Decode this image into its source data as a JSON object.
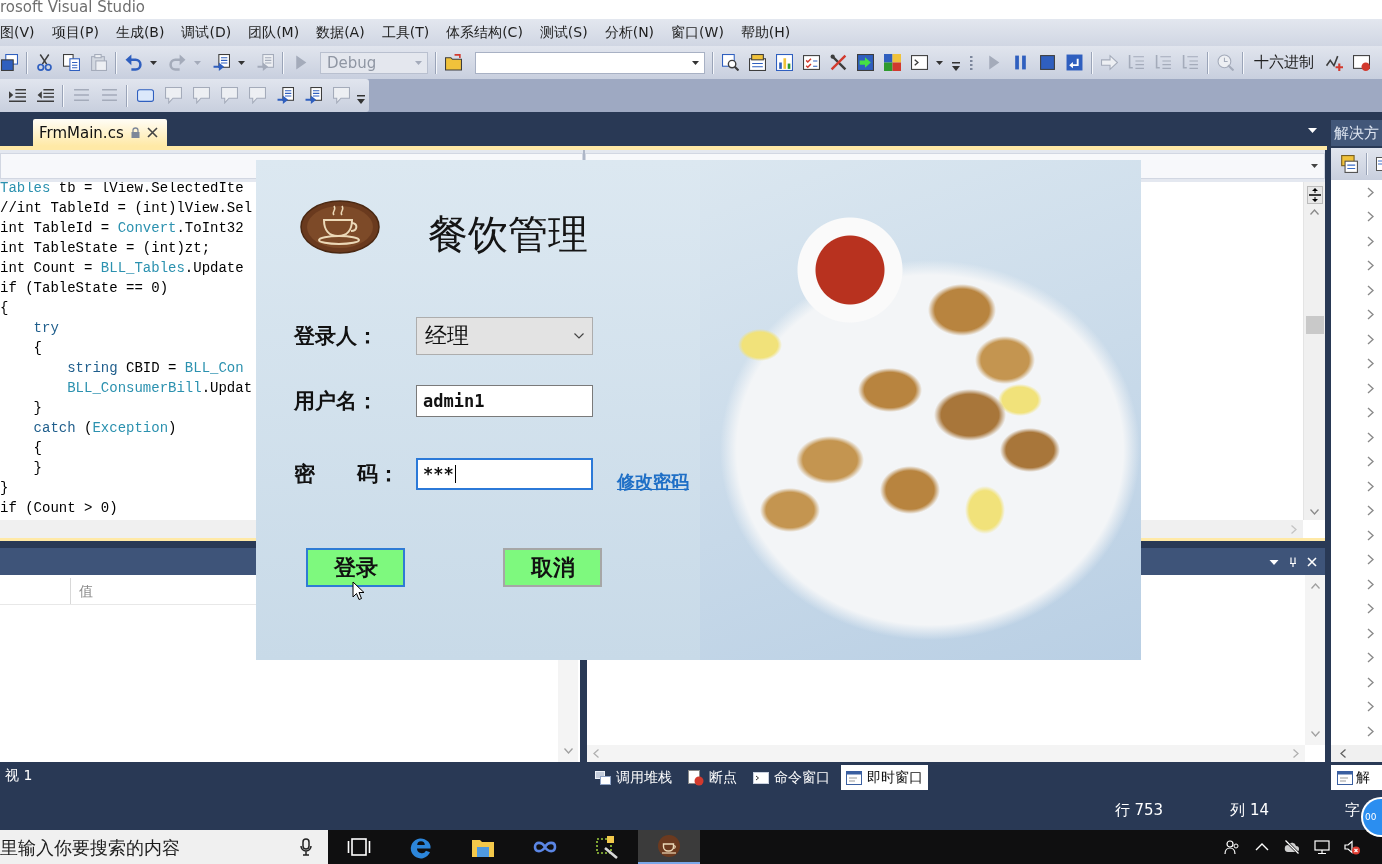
{
  "window": {
    "title": "rosoft Visual Studio"
  },
  "menu": [
    "图(V)",
    "项目(P)",
    "生成(B)",
    "调试(D)",
    "团队(M)",
    "数据(A)",
    "工具(T)",
    "体系结构(C)",
    "测试(S)",
    "分析(N)",
    "窗口(W)",
    "帮助(H)"
  ],
  "toolbar_1": [
    {
      "kind": "button",
      "disabled": false
    },
    {
      "kind": "separator"
    },
    {
      "kind": "button",
      "disabled": false
    },
    {
      "kind": "button",
      "disabled": false
    },
    {
      "kind": "button",
      "disabled": true
    },
    {
      "kind": "separator"
    },
    {
      "kind": "split",
      "disabled": false
    },
    {
      "kind": "split",
      "disabled": true
    },
    {
      "kind": "split",
      "disabled": false
    },
    {
      "kind": "button",
      "disabled": true
    },
    {
      "kind": "separator"
    },
    {
      "kind": "button",
      "disabled": true
    },
    {
      "kind": "combo",
      "value": "Debug",
      "disabled": true
    },
    {
      "kind": "separator"
    },
    {
      "kind": "button",
      "disabled": false
    },
    {
      "kind": "combo",
      "disabled": false
    },
    {
      "kind": "separator"
    },
    {
      "kind": "button",
      "disabled": false
    },
    {
      "kind": "button",
      "disabled": false
    },
    {
      "kind": "button",
      "disabled": false
    },
    {
      "kind": "button",
      "disabled": false
    },
    {
      "kind": "button",
      "disabled": false
    },
    {
      "kind": "button",
      "disabled": false
    },
    {
      "kind": "button",
      "disabled": false
    },
    {
      "kind": "split",
      "disabled": false
    },
    {
      "kind": "overflow"
    },
    {
      "kind": "grip"
    },
    {
      "kind": "button",
      "disabled": true
    },
    {
      "kind": "button",
      "disabled": false
    },
    {
      "kind": "button",
      "disabled": false
    },
    {
      "kind": "button",
      "disabled": false
    },
    {
      "kind": "separator"
    },
    {
      "kind": "button",
      "disabled": true
    },
    {
      "kind": "button",
      "disabled": true
    },
    {
      "kind": "button",
      "disabled": true
    },
    {
      "kind": "button",
      "disabled": true
    },
    {
      "kind": "separator"
    },
    {
      "kind": "button",
      "disabled": true
    },
    {
      "kind": "separator"
    },
    {
      "kind": "text",
      "label": "十六进制"
    },
    {
      "kind": "button",
      "disabled": false
    },
    {
      "kind": "button",
      "disabled": false
    }
  ],
  "toolbar_2": [
    {
      "kind": "button",
      "disabled": false
    },
    {
      "kind": "button",
      "disabled": false
    },
    {
      "kind": "separator"
    },
    {
      "kind": "button",
      "disabled": true
    },
    {
      "kind": "button",
      "disabled": true
    },
    {
      "kind": "separator"
    },
    {
      "kind": "button",
      "disabled": false
    },
    {
      "kind": "button",
      "disabled": true
    },
    {
      "kind": "button",
      "disabled": true
    },
    {
      "kind": "button",
      "disabled": true
    },
    {
      "kind": "button",
      "disabled": true
    },
    {
      "kind": "button",
      "disabled": false
    },
    {
      "kind": "button",
      "disabled": false
    },
    {
      "kind": "button",
      "disabled": true
    },
    {
      "kind": "overflow"
    }
  ],
  "document_tabs": [
    {
      "label": "FrmMain.cs",
      "selected": true,
      "locked": true
    }
  ],
  "editor": {
    "lines": [
      [
        {
          "text": "Tables",
          "kind": "type"
        },
        {
          "text": " tb = lView.SelectedIte",
          "kind": "plain"
        }
      ],
      [
        {
          "text": "//int TableId = (int)lView.Sel",
          "kind": "plain"
        }
      ],
      [
        {
          "text": "int TableId = ",
          "kind": "plain"
        },
        {
          "text": "Convert",
          "kind": "type"
        },
        {
          "text": ".ToInt32",
          "kind": "plain"
        }
      ],
      [
        {
          "text": "int TableState = (int)zt;",
          "kind": "plain"
        }
      ],
      [
        {
          "text": "int Count = ",
          "kind": "plain"
        },
        {
          "text": "BLL_Tables",
          "kind": "type"
        },
        {
          "text": ".Update",
          "kind": "plain"
        }
      ],
      [
        {
          "text": "if (TableState == 0)",
          "kind": "plain"
        }
      ],
      [
        {
          "text": "{",
          "kind": "plain"
        }
      ],
      [
        {
          "text": "    try",
          "kind": "keyword"
        }
      ],
      [
        {
          "text": "    {",
          "kind": "plain"
        }
      ],
      [
        {
          "text": "        string",
          "kind": "keyword"
        },
        {
          "text": " CBID = ",
          "kind": "plain"
        },
        {
          "text": "BLL_Con",
          "kind": "type"
        }
      ],
      [
        {
          "text": "        BLL_ConsumerBill",
          "kind": "type"
        },
        {
          "text": ".Updat",
          "kind": "plain"
        }
      ],
      [
        {
          "text": "    }",
          "kind": "plain"
        }
      ],
      [
        {
          "text": "    catch",
          "kind": "keyword"
        },
        {
          "text": " (",
          "kind": "plain"
        },
        {
          "text": "Exception",
          "kind": "type"
        },
        {
          "text": ")",
          "kind": "plain"
        }
      ],
      [
        {
          "text": "    {",
          "kind": "plain"
        }
      ],
      [
        {
          "text": "    }",
          "kind": "plain"
        }
      ],
      [
        {
          "text": "}",
          "kind": "plain"
        }
      ],
      [
        {
          "text": "if (Count > 0)",
          "kind": "plain"
        }
      ]
    ]
  },
  "watch_panel": {
    "column_2": "值",
    "tab": {
      "label": "视 1",
      "selected": false
    }
  },
  "output_panel": {
    "tabs": [
      {
        "label": "调用堆栈",
        "selected": false
      },
      {
        "label": "断点",
        "selected": false
      },
      {
        "label": "命令窗口",
        "selected": false
      },
      {
        "label": "即时窗口",
        "selected": true
      }
    ]
  },
  "solution_explorer": {
    "title": "解决方",
    "rows": [
      {
        "expanded": false
      },
      {
        "expanded": false
      },
      {
        "expanded": false
      },
      {
        "expanded": false
      },
      {
        "expanded": false
      },
      {
        "expanded": false
      },
      {
        "expanded": false
      },
      {
        "expanded": false
      },
      {
        "expanded": false
      },
      {
        "expanded": false
      },
      {
        "expanded": false
      },
      {
        "expanded": false
      },
      {
        "expanded": false
      },
      {
        "expanded": false
      },
      {
        "expanded": false
      },
      {
        "expanded": false
      },
      {
        "expanded": false
      },
      {
        "expanded": false
      },
      {
        "expanded": false
      },
      {
        "expanded": false
      },
      {
        "expanded": false
      },
      {
        "expanded": false
      },
      {
        "expanded": false
      }
    ],
    "tab": {
      "label": "解",
      "selected": true
    }
  },
  "status_bar": {
    "line": "行 753",
    "column": "列 14",
    "char": "字"
  },
  "overlay_badge": {
    "label": "00"
  },
  "taskbar": {
    "search": {
      "placeholder": "里输入你要搜索的内容"
    },
    "apps": [
      {
        "selected": false
      },
      {
        "selected": false
      },
      {
        "selected": false
      },
      {
        "selected": false
      },
      {
        "selected": false
      },
      {
        "selected": true
      }
    ]
  },
  "dialog": {
    "title": "餐饮管理",
    "fields": [
      {
        "kind": "select",
        "label": "登录人：",
        "value": "经理"
      },
      {
        "kind": "text",
        "label": "用户名：",
        "value": "admin1",
        "focused": false
      },
      {
        "kind": "password",
        "label": "密　　码：",
        "value": "***",
        "focused": true,
        "link": "修改密码"
      }
    ],
    "buttons": [
      {
        "label": "登录",
        "focused": true
      },
      {
        "label": "取消",
        "focused": false
      }
    ]
  }
}
